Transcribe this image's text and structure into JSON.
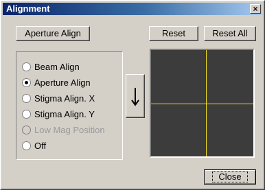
{
  "window": {
    "title": "Alignment",
    "close_glyph": "×"
  },
  "buttons": {
    "aperture_align": "Aperture Align",
    "reset": "Reset",
    "reset_all": "Reset All",
    "close": "Close"
  },
  "radios": [
    {
      "label": "Beam  Align",
      "checked": false,
      "enabled": true
    },
    {
      "label": "Aperture Align",
      "checked": true,
      "enabled": true
    },
    {
      "label": "Stigma Align. X",
      "checked": false,
      "enabled": true
    },
    {
      "label": "Stigma Align. Y",
      "checked": false,
      "enabled": true
    },
    {
      "label": "Low Mag Position",
      "checked": false,
      "enabled": false
    },
    {
      "label": "Off",
      "checked": false,
      "enabled": true
    }
  ],
  "arrow": {
    "icon": "arrow-down-icon"
  },
  "display": {
    "crosshair_color": "#f0e020",
    "background": "#3c3c3c"
  }
}
